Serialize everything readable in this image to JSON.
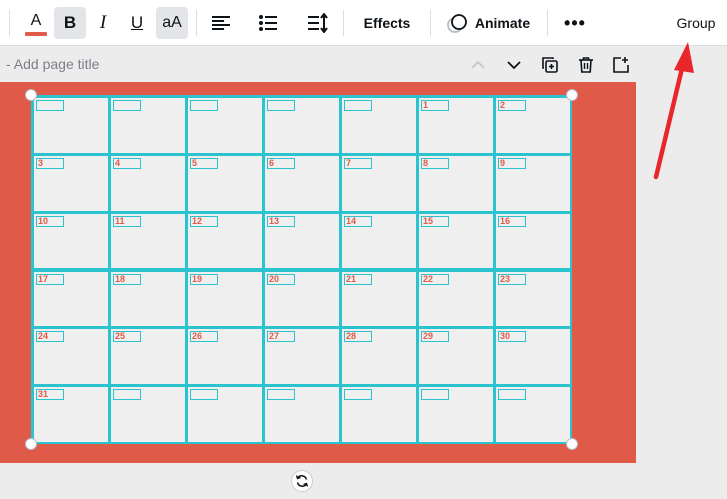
{
  "toolbar": {
    "text_color_label": "A",
    "text_color_swatch": "#e15a4a",
    "bold_label": "B",
    "italic_label": "I",
    "underline_label": "U",
    "case_label": "aA",
    "effects_label": "Effects",
    "animate_label": "Animate",
    "more_label": "•••",
    "group_label": "Group",
    "icons": [
      "text-color-icon",
      "align-left-icon",
      "bullet-list-icon",
      "line-spacing-icon",
      "animate-icon",
      "more-icon"
    ]
  },
  "page": {
    "title_placeholder": "- Add page title",
    "icons": [
      "chevron-up-icon",
      "chevron-down-icon",
      "duplicate-page-icon",
      "trash-icon",
      "add-page-icon"
    ]
  },
  "calendar": {
    "rows": [
      [
        "",
        "",
        "",
        "",
        "",
        "1",
        "2"
      ],
      [
        "3",
        "4",
        "5",
        "6",
        "7",
        "8",
        "9"
      ],
      [
        "10",
        "11",
        "12",
        "13",
        "14",
        "15",
        "16"
      ],
      [
        "17",
        "18",
        "19",
        "20",
        "21",
        "22",
        "23"
      ],
      [
        "24",
        "25",
        "26",
        "27",
        "28",
        "29",
        "30"
      ],
      [
        "31",
        "",
        "",
        "",
        "",
        "",
        ""
      ]
    ]
  },
  "colors": {
    "canvas_background": "#df5a48",
    "grid_accent": "#2bc3cd",
    "annotation_arrow": "#e8262c"
  }
}
